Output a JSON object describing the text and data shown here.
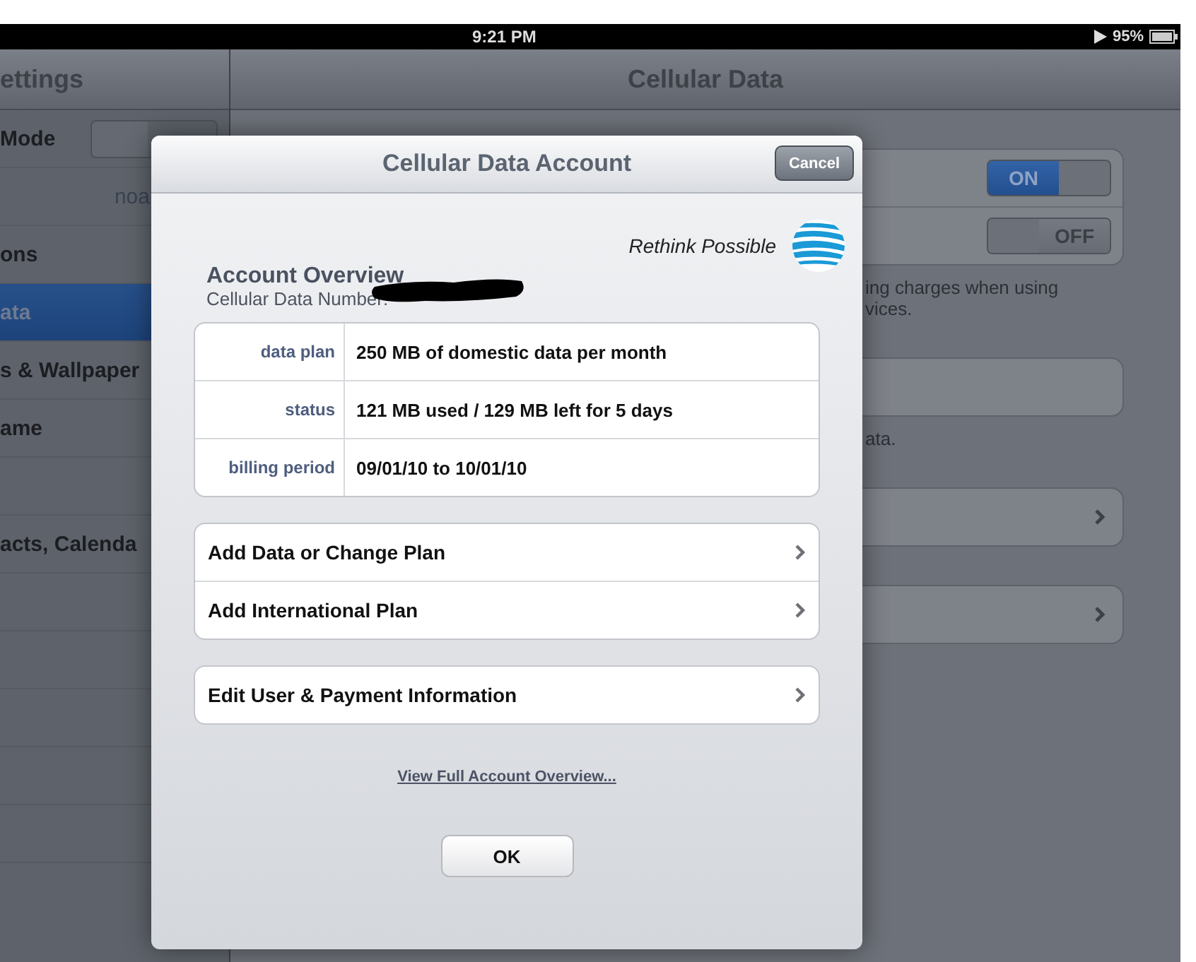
{
  "status_bar": {
    "time": "9:21 PM",
    "battery": "95%"
  },
  "sidebar": {
    "title": "ettings",
    "items": [
      {
        "kind": "toggle",
        "label": "Mode",
        "on": false,
        "selected": false
      },
      {
        "kind": "value",
        "value": "noa",
        "selected": false
      },
      {
        "kind": "plain",
        "label": "ons",
        "selected": false
      },
      {
        "kind": "plain",
        "label": "ata",
        "selected": true
      },
      {
        "kind": "plain",
        "label": "s & Wallpaper",
        "selected": false
      },
      {
        "kind": "plain",
        "label": "ame",
        "selected": false
      },
      {
        "kind": "empty",
        "selected": false
      },
      {
        "kind": "plain",
        "label": "acts, Calenda",
        "selected": false
      },
      {
        "kind": "empty",
        "selected": false
      },
      {
        "kind": "empty",
        "selected": false
      },
      {
        "kind": "empty",
        "selected": false
      },
      {
        "kind": "empty",
        "selected": false
      },
      {
        "kind": "empty",
        "selected": false
      }
    ]
  },
  "detail": {
    "title": "Cellular Data",
    "groups": [
      {
        "rows": [
          {
            "kind": "toggle",
            "label": "ON",
            "on": true
          },
          {
            "kind": "toggle",
            "label": "OFF",
            "on": false
          }
        ],
        "footer_lines": [
          "ing charges when using",
          "vices."
        ]
      },
      {
        "rows": [
          {
            "kind": "blank"
          }
        ],
        "footer_lines": [
          "ata."
        ]
      },
      {
        "rows": [
          {
            "kind": "chevron"
          }
        ]
      },
      {
        "rows": [
          {
            "kind": "chevron"
          }
        ]
      }
    ]
  },
  "dialog": {
    "title": "Cellular Data Account",
    "cancel": "Cancel",
    "tagline": "Rethink Possible",
    "heading": "Account Overview",
    "number_label": "Cellular Data Number:",
    "details": [
      {
        "label": "data plan",
        "value": "250 MB of domestic data per month"
      },
      {
        "label": "status",
        "value": "121 MB used / 129 MB left for 5 days"
      },
      {
        "label": "billing period",
        "value": "09/01/10 to 10/01/10"
      }
    ],
    "action_groups": [
      {
        "items": [
          "Add Data or Change Plan",
          "Add International Plan"
        ]
      },
      {
        "items": [
          "Edit User & Payment Information"
        ]
      }
    ],
    "link": "View Full Account Overview...",
    "ok": "OK"
  }
}
